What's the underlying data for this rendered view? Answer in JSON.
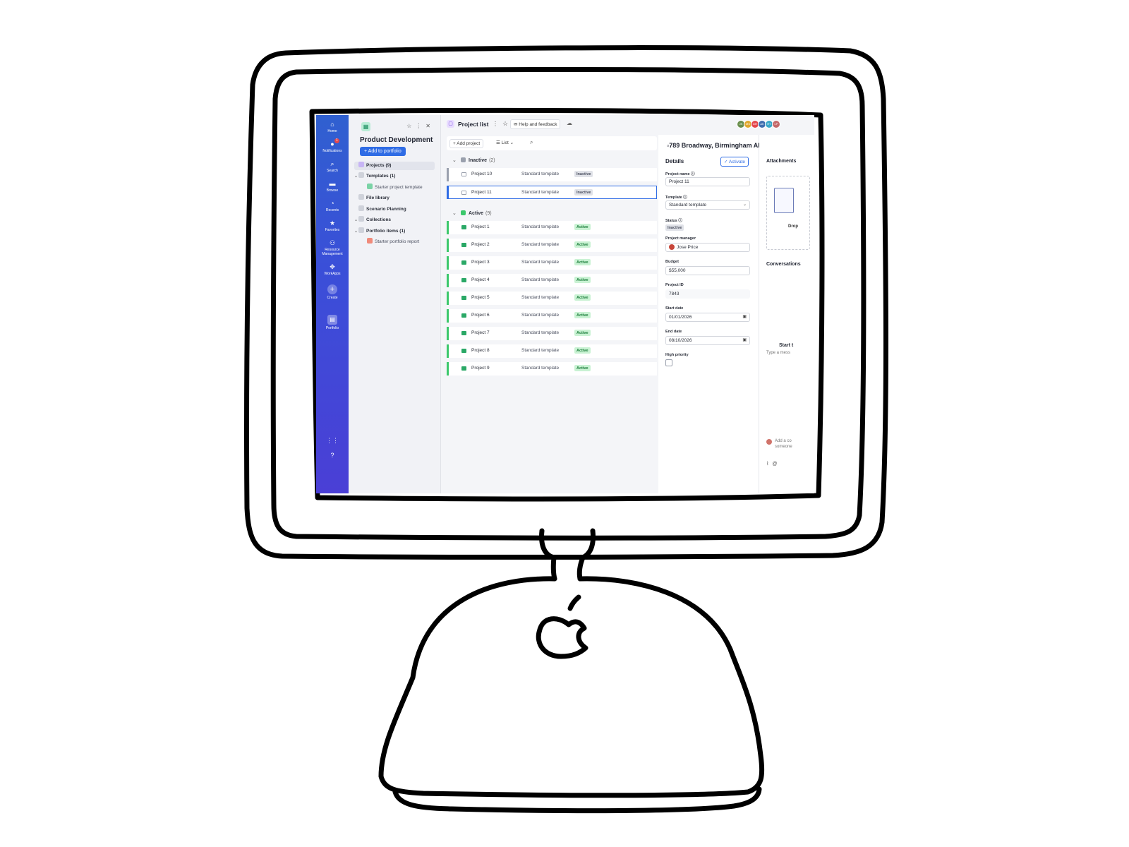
{
  "rail": {
    "items": [
      {
        "label": "Home",
        "icon": "home-icon"
      },
      {
        "label": "Notifications",
        "icon": "bell-icon",
        "badge": "1"
      },
      {
        "label": "Search",
        "icon": "search-icon"
      },
      {
        "label": "Browse",
        "icon": "folder-icon"
      },
      {
        "label": "Recents",
        "icon": "clock-icon"
      },
      {
        "label": "Favorites",
        "icon": "star-icon"
      },
      {
        "label": "Resource Management",
        "icon": "people-icon"
      },
      {
        "label": "WorkApps",
        "icon": "apps-icon"
      },
      {
        "label": "Create",
        "icon": "plus-icon"
      },
      {
        "label": "Portfolio",
        "icon": "portfolio-icon"
      }
    ]
  },
  "sidebar": {
    "title": "Product Development",
    "add_button": "Add to portfolio",
    "items": [
      {
        "label": "Projects (9)"
      },
      {
        "label": "Templates (1)"
      },
      {
        "label": "Starter project template"
      },
      {
        "label": "File library"
      },
      {
        "label": "Scenario Planning"
      },
      {
        "label": "Collections"
      },
      {
        "label": "Portfolio items (1)"
      },
      {
        "label": "Starter portfolio report"
      }
    ]
  },
  "topbar": {
    "title": "Project list",
    "help": "Help and feedback",
    "avatars": [
      "JS",
      "MS",
      "DR",
      "AK",
      "RT",
      "LP"
    ]
  },
  "toolbar": {
    "add_project": "Add project",
    "view": "List"
  },
  "groups": {
    "inactive": {
      "label": "Inactive",
      "count": "(2)",
      "color": "#9aa0ad"
    },
    "active": {
      "label": "Active",
      "count": "(9)",
      "color": "#3cc86c"
    }
  },
  "rows": [
    {
      "name": "Project 10",
      "template": "Standard template",
      "status": "Inactive"
    },
    {
      "name": "Project 11",
      "template": "Standard template",
      "status": "Inactive"
    },
    {
      "name": "Project 1",
      "template": "Standard template",
      "status": "Active"
    },
    {
      "name": "Project 2",
      "template": "Standard template",
      "status": "Active"
    },
    {
      "name": "Project 3",
      "template": "Standard template",
      "status": "Active"
    },
    {
      "name": "Project 4",
      "template": "Standard template",
      "status": "Active"
    },
    {
      "name": "Project 5",
      "template": "Standard template",
      "status": "Active"
    },
    {
      "name": "Project 6",
      "template": "Standard template",
      "status": "Active"
    },
    {
      "name": "Project 7",
      "template": "Standard template",
      "status": "Active"
    },
    {
      "name": "Project 8",
      "template": "Standard template",
      "status": "Active"
    },
    {
      "name": "Project 9",
      "template": "Standard template",
      "status": "Active"
    }
  ],
  "detail": {
    "address": "789 Broadway, Birmingham AL",
    "heading": "Details",
    "activate": "Activate",
    "project_name_label": "Project name",
    "project_name": "Project 11",
    "template_label": "Template",
    "template": "Standard template",
    "status_label": "Status",
    "status": "Inactive",
    "manager_label": "Project manager",
    "manager": "Jose Price",
    "budget_label": "Budget",
    "budget": "$55,000",
    "id_label": "Project ID",
    "id": "7843",
    "start_label": "Start date",
    "start": "01/01/2026",
    "end_label": "End date",
    "end": "08/10/2026",
    "priority_label": "High priority"
  },
  "right_panel": {
    "attachments": "Attachments",
    "drop": "Drop",
    "conversations": "Conversations",
    "start": "Start t",
    "type": "Type a mess",
    "add_comment": "Add a co",
    "add_comment2": "someone"
  },
  "colors": {
    "accent": "#2f6ce5",
    "rail_top": "#3060d0",
    "rail_bottom": "#4a3fd6",
    "active_green": "#3cc86c"
  }
}
